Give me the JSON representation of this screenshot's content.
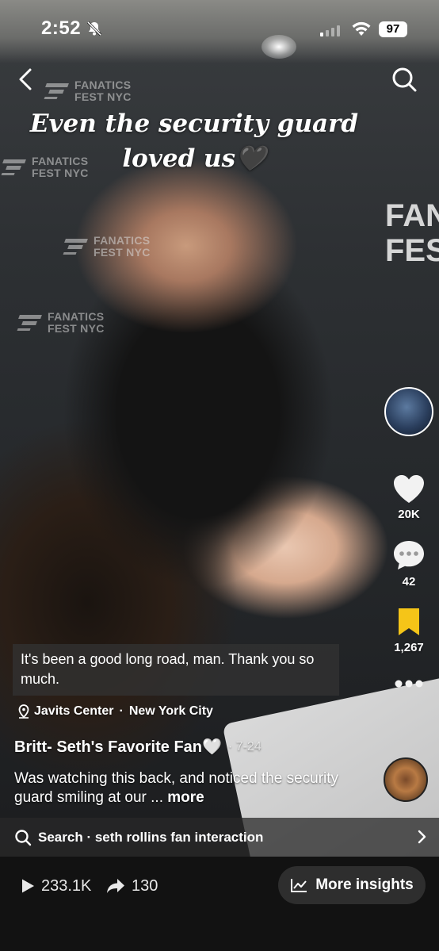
{
  "status_bar": {
    "time": "2:52",
    "battery": "97"
  },
  "video": {
    "overlay_caption": [
      "Even the security guard",
      "loved us🖤"
    ],
    "backdrop_logo": [
      "FANATICS",
      "FEST NYC"
    ],
    "backdrop_big_text": [
      "FAN",
      "FES"
    ],
    "subtitle": "It's been a good long road, man. Thank you so much."
  },
  "right_rail": {
    "likes": "20K",
    "comments": "42",
    "saves": "1,267"
  },
  "post": {
    "location": "Javits Center",
    "location_city": "New York City",
    "separator": "·",
    "author": "Britt- Seth's Favorite Fan🤍",
    "date": "· 7-24",
    "description": "Was watching this back, and noticed the security guard smiling at our ...",
    "more_label": "more"
  },
  "search_suggestion": {
    "label": "Search",
    "separator": "·",
    "query": "seth rollins fan interaction"
  },
  "bottom_bar": {
    "views": "233.1K",
    "shares": "130",
    "insights_label": "More insights"
  },
  "colors": {
    "save_active": "#f5c518",
    "bottom_bg": "#121212"
  }
}
